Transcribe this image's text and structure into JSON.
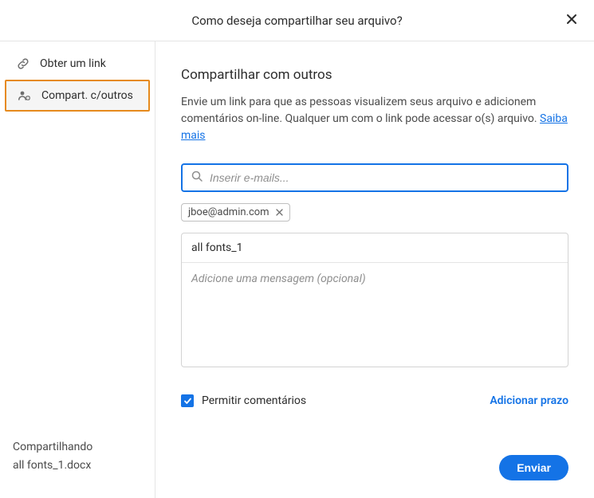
{
  "header": {
    "title": "Como deseja compartilhar seu arquivo?"
  },
  "sidebar": {
    "items": [
      {
        "label": "Obter um link"
      },
      {
        "label": "Compart. c/outros"
      }
    ],
    "footer_line1": "Compartilhando",
    "footer_line2": "all fonts_1.docx"
  },
  "main": {
    "title": "Compartilhar com outros",
    "description": "Envie um link para que as pessoas visualizem seus arquivo e adicionem comentários on-line. Qualquer um com o link pode acessar o(s) arquivo. ",
    "learn_more": "Saiba mais",
    "email_placeholder": "Inserir e-mails...",
    "chip_email": "jboe@admin.com",
    "file_name": "all fonts_1",
    "message_placeholder": "Adicione uma mensagem (opcional)",
    "allow_comments_label": "Permitir comentários",
    "add_deadline": "Adicionar prazo",
    "send_label": "Enviar"
  }
}
